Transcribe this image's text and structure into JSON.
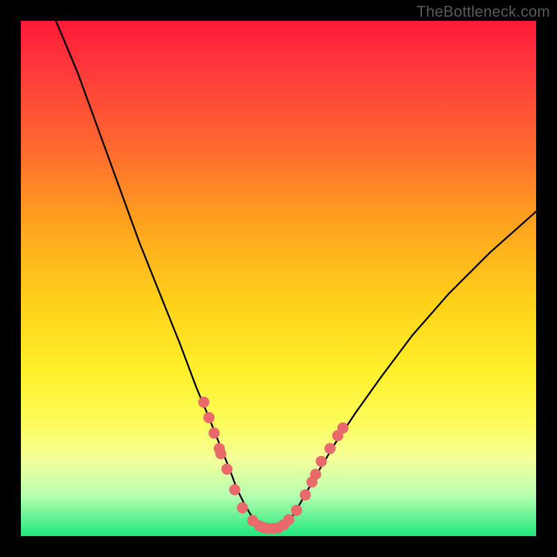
{
  "watermark": "TheBottleneck.com",
  "chart_data": {
    "type": "line",
    "title": "",
    "xlabel": "",
    "ylabel": "",
    "xlim": [
      0,
      100
    ],
    "ylim": [
      0,
      100
    ],
    "grid": false,
    "legend": false,
    "series": [
      {
        "name": "bottleneck-curve",
        "x": [
          6.8,
          11,
          15,
          19,
          23,
          27,
          31,
          34,
          36.5,
          38.5,
          40.5,
          42,
          43.5,
          45,
          47,
          49,
          51,
          52.5,
          54,
          56,
          58,
          61,
          65,
          70,
          76,
          83,
          91,
          100
        ],
        "y": [
          100,
          90,
          79,
          68,
          57,
          47,
          37,
          29,
          23,
          18,
          13,
          9,
          6,
          3.5,
          2,
          1.5,
          2,
          3.5,
          6,
          9.5,
          13,
          18,
          24,
          31,
          39,
          47,
          55,
          63
        ],
        "color": "#000000"
      },
      {
        "name": "marker-dots",
        "type": "scatter",
        "points": [
          {
            "x": 35.5,
            "y": 26
          },
          {
            "x": 36.5,
            "y": 23
          },
          {
            "x": 37.5,
            "y": 20
          },
          {
            "x": 38.5,
            "y": 17
          },
          {
            "x": 38.8,
            "y": 16
          },
          {
            "x": 40,
            "y": 13
          },
          {
            "x": 41.5,
            "y": 9
          },
          {
            "x": 43,
            "y": 5.5
          },
          {
            "x": 45,
            "y": 3
          },
          {
            "x": 46.3,
            "y": 2
          },
          {
            "x": 47.2,
            "y": 1.6
          },
          {
            "x": 48,
            "y": 1.5
          },
          {
            "x": 49,
            "y": 1.5
          },
          {
            "x": 50,
            "y": 1.6
          },
          {
            "x": 51,
            "y": 2.2
          },
          {
            "x": 52,
            "y": 3.2
          },
          {
            "x": 53.5,
            "y": 5
          },
          {
            "x": 55.2,
            "y": 8
          },
          {
            "x": 56.5,
            "y": 10.5
          },
          {
            "x": 57.2,
            "y": 12
          },
          {
            "x": 58.3,
            "y": 14.5
          },
          {
            "x": 60,
            "y": 17
          },
          {
            "x": 61.5,
            "y": 19.5
          },
          {
            "x": 62.5,
            "y": 21
          }
        ],
        "color": "#e96a6a",
        "radius": 8
      }
    ]
  }
}
